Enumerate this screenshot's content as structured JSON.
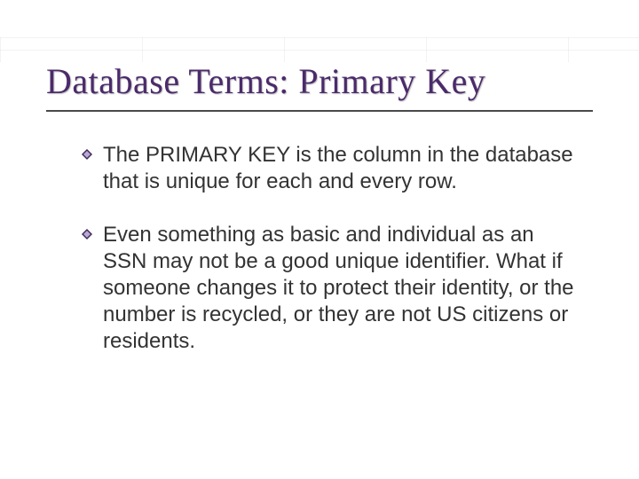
{
  "title": "Database Terms:  Primary Key",
  "bullets": [
    "The PRIMARY KEY is the column in the database that is unique for each and every row.",
    "Even something as basic and individual as an SSN may not be a good unique identifier.  What if someone changes it to protect their identity, or the number is recycled, or they are not US citizens or residents."
  ],
  "colors": {
    "title": "#4b2b6b",
    "body": "#333333",
    "bullet_dark": "#3b2a57",
    "bullet_light": "#b9a8d6"
  }
}
